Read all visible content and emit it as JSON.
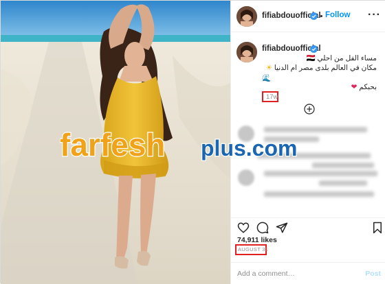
{
  "post": {
    "username": "fifiabdouofficial",
    "follow_separator": "•",
    "follow_label": "Follow",
    "more_label": "···"
  },
  "caption": {
    "line1": "مساء الفل من احلي 🇪🇬",
    "line2_text": "مكان في العالم بلدى مصر ام الدنيا",
    "line2_emoji": "☀",
    "line3_emoji": "🌊",
    "line4_text": "بحبكم",
    "line4_emoji": "❤",
    "time": "17w"
  },
  "stats": {
    "likes": "74,911 likes",
    "date": "AUGUST 31"
  },
  "comment": {
    "placeholder": "Add a comment…",
    "post_label": "Post"
  },
  "watermark": {
    "brand": "farfesh",
    "suffix": "plus.com"
  },
  "icons": {
    "verified": "verified-badge-icon",
    "load_more": "plus-circle-icon",
    "like": "heart-icon",
    "comment": "comment-icon",
    "share": "paper-plane-icon",
    "save": "bookmark-icon"
  },
  "colors": {
    "accent": "#0095f6",
    "highlight_box": "#e02020",
    "dress": "#e9b92a",
    "sky": "#3a8fcf",
    "sea": "#3fb3c7",
    "sand": "#e6dfd0"
  }
}
